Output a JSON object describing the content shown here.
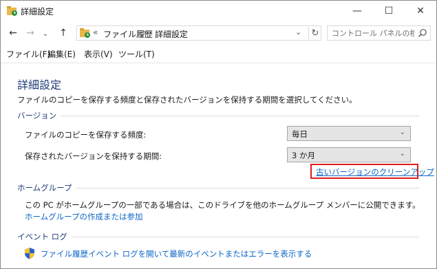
{
  "window": {
    "title": "詳細設定",
    "minimize_glyph": "—",
    "maximize_glyph": "☐",
    "close_glyph": "✕"
  },
  "nav": {
    "back_glyph": "←",
    "forward_glyph": "→",
    "recent_glyph": "⌄",
    "up_glyph": "↑",
    "overflow_glyph": "«",
    "breadcrumb_1": "ファイル履歴",
    "breadcrumb_separator": "›",
    "breadcrumb_2": "詳細設定",
    "dropdown_glyph": "⌄",
    "refresh_glyph": "↻",
    "search_placeholder": "コントロール パネルの検..."
  },
  "menu": [
    "ファイル(F)",
    "編集(E)",
    "表示(V)",
    "ツール(T)"
  ],
  "content": {
    "heading": "詳細設定",
    "description": "ファイルのコピーを保存する頻度と保存されたバージョンを保持する期間を選択してください。",
    "versions": {
      "section_label": "バージョン",
      "frequency_label": "ファイルのコピーを保存する頻度:",
      "frequency_value": "毎日",
      "retention_label": "保存されたバージョンを保持する期間:",
      "retention_value": "3 か月",
      "cleanup_link": "古いバージョンのクリーンアップ"
    },
    "homegroup": {
      "section_label": "ホームグループ",
      "text": "この PC がホームグループの一部である場合は、このドライブを他のホームグループ メンバーに公開できます。",
      "link": "ホームグループの作成または参加"
    },
    "eventlog": {
      "section_label": "イベント ログ",
      "link": "ファイル履歴イベント ログを開いて最新のイベントまたはエラーを表示する"
    }
  },
  "colors": {
    "heading": "#1e3a78",
    "link": "#0a64c8",
    "highlight_border": "#e21a1a"
  }
}
